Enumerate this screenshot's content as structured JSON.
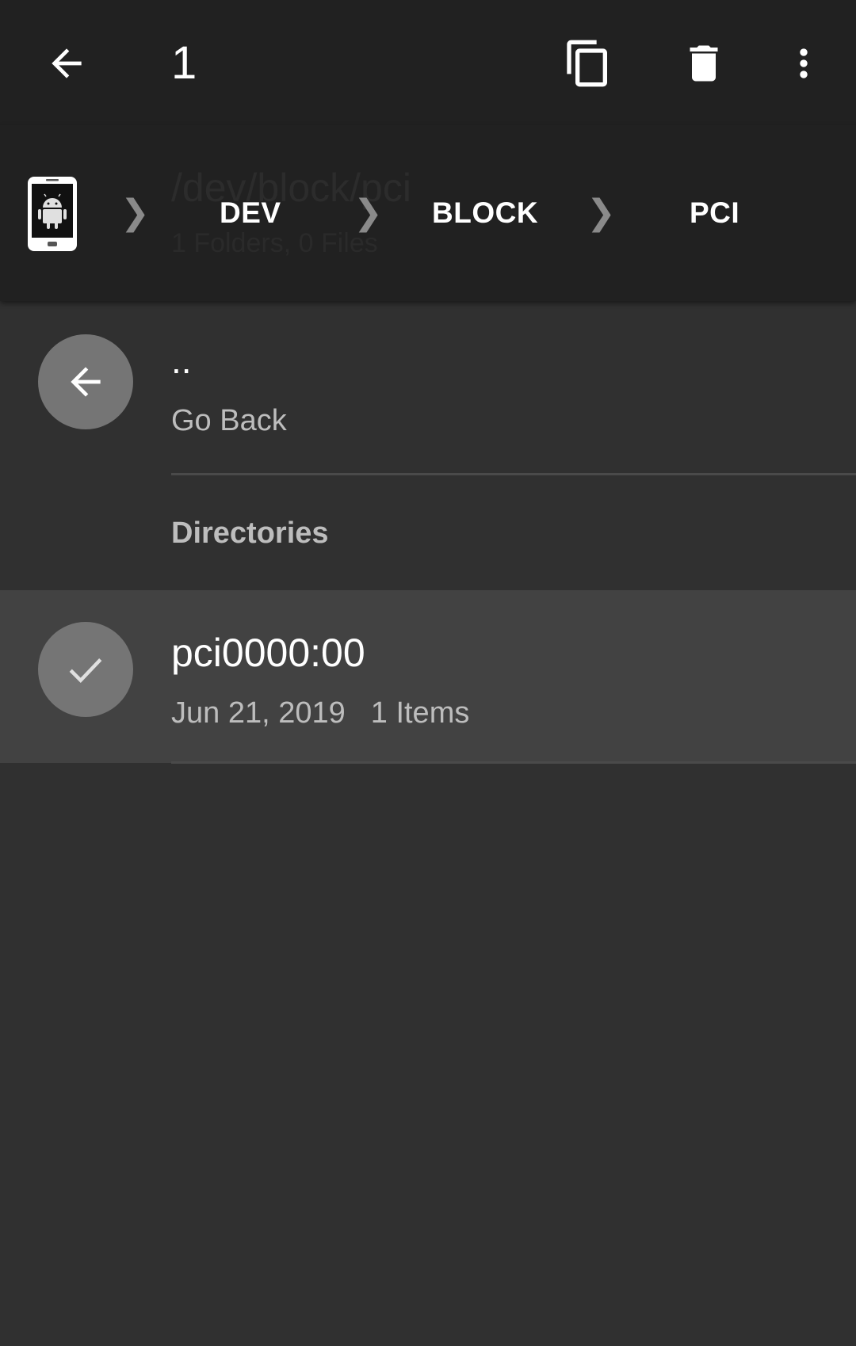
{
  "appbar": {
    "selected_count": "1",
    "icons": {
      "back": "arrow-left-icon",
      "copy": "copy-icon",
      "delete": "trash-icon",
      "more": "more-vert-icon"
    }
  },
  "breadcrumb": {
    "ghost_path": "/dev/block/pci",
    "ghost_counts": "1 Folders, 0 Files",
    "device_icon": "android-phone-icon",
    "separator": "❯",
    "items": [
      {
        "label": "DEV"
      },
      {
        "label": "BLOCK"
      },
      {
        "label": "PCI"
      }
    ]
  },
  "list": {
    "go_back": {
      "title": "..",
      "subtitle": "Go Back",
      "icon": "arrow-left-icon"
    },
    "section_header": "Directories",
    "items": [
      {
        "name": "pci0000:00",
        "date": "Jun 21, 2019",
        "count": "1 Items",
        "selected": true,
        "icon": "check-icon"
      }
    ]
  },
  "colors": {
    "appbar_bg": "#212121",
    "list_bg": "#303030",
    "selected_row_bg": "#424242",
    "avatar_bg": "#757575",
    "secondary_text": "#bdbdbd"
  }
}
